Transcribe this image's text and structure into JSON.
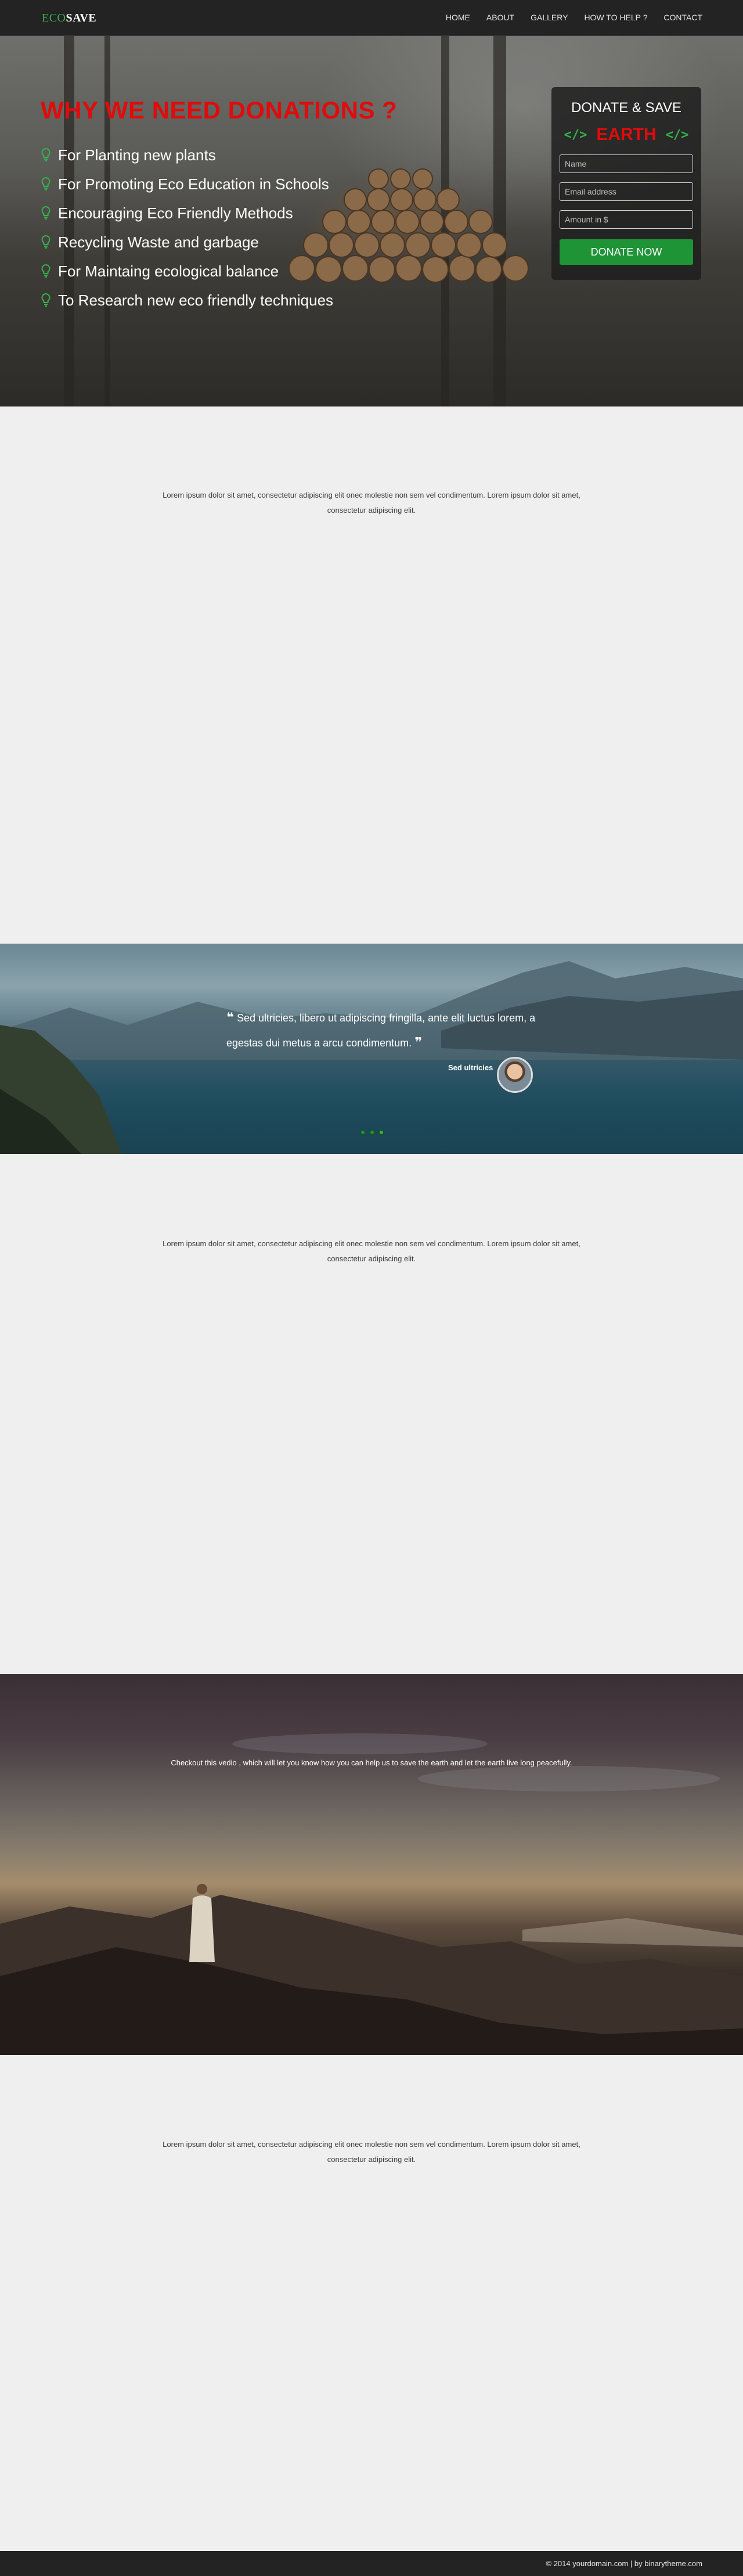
{
  "brand": {
    "eco": "ECO",
    "save": "SAVE"
  },
  "nav": {
    "items": [
      "HOME",
      "ABOUT",
      "GALLERY",
      "HOW TO HELP ?",
      "CONTACT"
    ]
  },
  "hero": {
    "title": "WHY WE NEED DONATIONS ?",
    "reasons": [
      "For Planting new plants",
      "For Promoting Eco Education in Schools",
      "Encouraging Eco Friendly Methods",
      "Recycling Waste and garbage",
      "For Maintaing ecological balance",
      "To Research new eco friendly techniques"
    ],
    "reason_icon": "lightbulb-icon"
  },
  "donate": {
    "title": "DONATE & SAVE",
    "subtitle": "EARTH",
    "subtitle_icon": "code-icon",
    "name_placeholder": "Name",
    "email_placeholder": "Email address",
    "amount_placeholder": "Amount in $",
    "button_label": "DONATE NOW"
  },
  "sections": {
    "lorem": "Lorem ipsum dolor sit amet, consectetur adipiscing elit onec molestie non sem vel condimentum. Lorem ipsum dolor sit amet, consectetur adipiscing elit."
  },
  "testimonial": {
    "quote": "Sed ultricies, libero ut adipiscing fringilla, ante elit luctus lorem, a egestas dui metus a arcu condimentum.",
    "author": "Sed ultricies",
    "slide_count": 3,
    "active_slide": 3
  },
  "video": {
    "caption": "Checkout this vedio , which will let you know how you can help us to save the earth and let the earth live long peacefully."
  },
  "footer": {
    "text": "© 2014 yourdomain.com | by binarytheme.com"
  },
  "colors": {
    "accent_green": "#1e9436",
    "brand_green": "#35b34a",
    "red": "#e00b0b",
    "dark": "#232323"
  }
}
